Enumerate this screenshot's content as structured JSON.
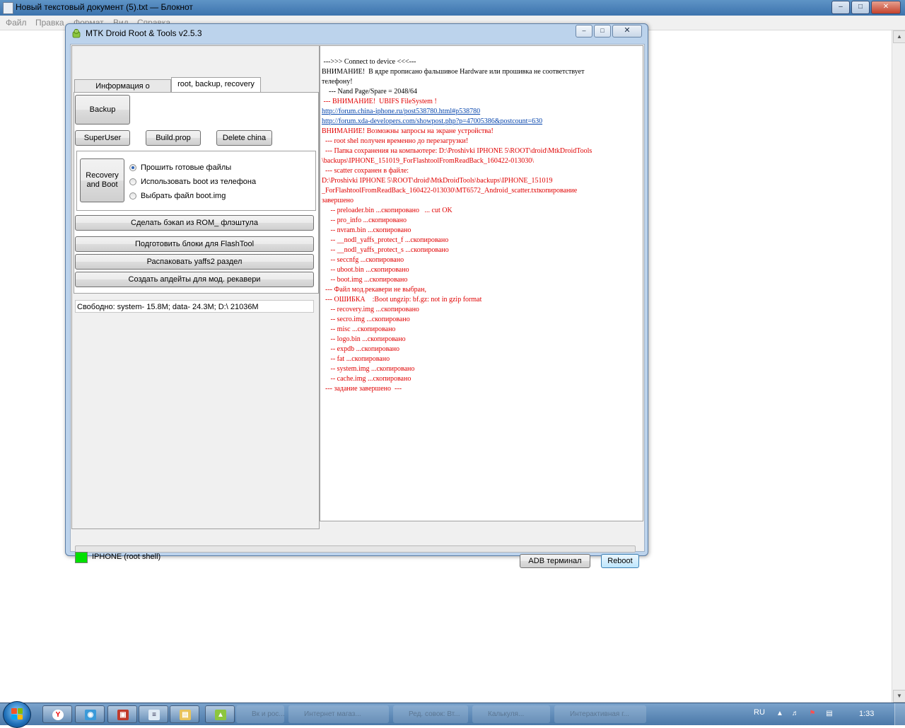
{
  "notepad": {
    "title": "Новый текстовый документ (5).txt — Блокнот",
    "menu": [
      "Файл",
      "Правка",
      "Формат",
      "Вид",
      "Справка"
    ]
  },
  "mtk": {
    "title": "MTK Droid Root & Tools v2.5.3",
    "tabs": [
      "Информация о телефоне",
      "root, backup, recovery"
    ],
    "buttons": {
      "backup": "Backup",
      "superuser": "SuperUser",
      "buildprop": "Build.prop",
      "delete_china": "Delete china",
      "recovery_boot": "Recovery and Boot",
      "rom_backup": "Сделать бэкап из ROM_ флэштула",
      "flashtool_blocks": "Подготовить блоки для FlashTool",
      "unpack_yaffs2": "Распаковать yaffs2 раздел",
      "create_updates": "Создать  апдейты  для мод. рекавери",
      "adb_terminal": "ADB терминал",
      "reboot": "Reboot"
    },
    "radios": [
      {
        "label": "Прошить готовые файлы",
        "checked": true
      },
      {
        "label": "Использовать boot из телефона",
        "checked": false
      },
      {
        "label": "Выбрать файл boot.img",
        "checked": false
      }
    ],
    "free_space": "Свободно: system- 15.8M; data- 24.3M;  D:\\ 21036M",
    "device_label": "IPHONE (root shell)",
    "device_status_color": "#00e000",
    "log_colors": {
      "normal": "#000000",
      "error": "#e00000",
      "link": "#0645ad"
    },
    "log": [
      {
        "text": " --->>> Connect to device <<<---",
        "kind": "normal"
      },
      {
        "text": "ВНИМАНИЕ!  В ядре прописано фальшивое Hardware или прошивка не соответствует",
        "kind": "normal"
      },
      {
        "text": "телефону!",
        "kind": "normal"
      },
      {
        "text": "    --- Nand Page/Spare = 2048/64",
        "kind": "normal"
      },
      {
        "text": " --- ВНИМАНИЕ!  UBIFS FileSystem !",
        "kind": "error"
      },
      {
        "text": "http://forum.china-iphone.ru/post538780.html#p538780",
        "kind": "link"
      },
      {
        "text": "http://forum.xda-developers.com/showpost.php?p=47005386&postcount=630",
        "kind": "link"
      },
      {
        "text": "ВНИМАНИЕ! Возможны запросы на экране устройства!",
        "kind": "error"
      },
      {
        "text": "  --- root shel получен временно до перезагрузки!",
        "kind": "error"
      },
      {
        "text": "  --- Папка сохранения на компьютере: D:\\Proshivki IPHONE 5\\ROOT\\droid\\MtkDroidTools",
        "kind": "error"
      },
      {
        "text": "\\backups\\IPHONE_151019_ForFlashtoolFromReadBack_160422-013030\\",
        "kind": "error"
      },
      {
        "text": "  --- scatter сохранен в файле:",
        "kind": "error"
      },
      {
        "text": "D:\\Proshivki IPHONE 5\\ROOT\\droid\\MtkDroidTools\\backups\\IPHONE_151019",
        "kind": "error"
      },
      {
        "text": "_ForFlashtoolFromReadBack_160422-013030\\MT6572_Android_scatter.txtкопирование",
        "kind": "error"
      },
      {
        "text": "завершено",
        "kind": "error"
      },
      {
        "text": "     -- preloader.bin ...скопировано   ... cut OK",
        "kind": "error"
      },
      {
        "text": "     -- pro_info ...скопировано",
        "kind": "error"
      },
      {
        "text": "     -- nvram.bin ...скопировано",
        "kind": "error"
      },
      {
        "text": "     -- __nodl_yaffs_protect_f ...скопировано",
        "kind": "error"
      },
      {
        "text": "     -- __nodl_yaffs_protect_s ...скопировано",
        "kind": "error"
      },
      {
        "text": "     -- seccnfg ...скопировано",
        "kind": "error"
      },
      {
        "text": "     -- uboot.bin ...скопировано",
        "kind": "error"
      },
      {
        "text": "     -- boot.img ...скопировано",
        "kind": "error"
      },
      {
        "text": "  --- Файл мод.рекавери не выбран,",
        "kind": "error"
      },
      {
        "text": "  --- ОШИБКА    :Boot ungzip: bf.gz: not in gzip format",
        "kind": "error"
      },
      {
        "text": "     -- recovery.img ...скопировано",
        "kind": "error"
      },
      {
        "text": "     -- secro.img ...скопировано",
        "kind": "error"
      },
      {
        "text": "     -- misc ...скопировано",
        "kind": "error"
      },
      {
        "text": "     -- logo.bin ...скопировано",
        "kind": "error"
      },
      {
        "text": "     -- expdb ...скопировано",
        "kind": "error"
      },
      {
        "text": "     -- fat ...скопировано",
        "kind": "error"
      },
      {
        "text": "     -- system.img ...скопировано",
        "kind": "error"
      },
      {
        "text": "     -- cache.img ...скопировано",
        "kind": "error"
      },
      {
        "text": "  --- задание завершено  ---",
        "kind": "error"
      }
    ]
  },
  "taskbar": {
    "language": "RU",
    "clock": "1:33",
    "pinned_icons": [
      "yandex-browser-icon",
      "network-icon",
      "toolbox-icon",
      "notepad-icon",
      "explorer-icon",
      "mtk-droid-icon"
    ],
    "faded_items": [
      "Вк и рос...",
      "Интернет магаз...",
      "Ред. совок: Вт...",
      "Калькуля...",
      "Интерактивная г..."
    ]
  }
}
